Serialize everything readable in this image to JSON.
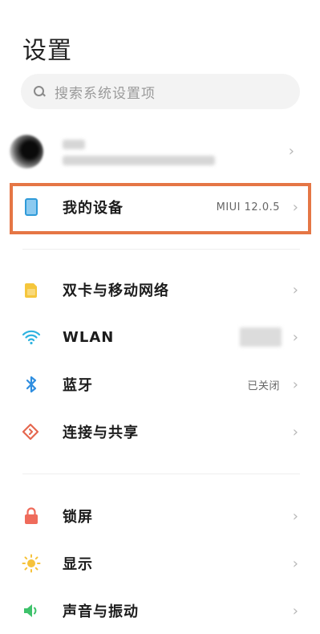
{
  "header": {
    "title": "设置"
  },
  "search": {
    "placeholder": "搜索系统设置项"
  },
  "device": {
    "label": "我的设备",
    "value": "MIUI 12.0.5"
  },
  "network_group": [
    {
      "label": "双卡与移动网络",
      "value": "",
      "icon": "sim-card-icon",
      "color": "#f5c63c"
    },
    {
      "label": "WLAN",
      "value": "",
      "icon": "wifi-icon",
      "color": "#2fb3e0"
    },
    {
      "label": "蓝牙",
      "value": "已关闭",
      "icon": "bluetooth-icon",
      "color": "#2f8ee0"
    },
    {
      "label": "连接与共享",
      "value": "",
      "icon": "connection-share-icon",
      "color": "#e5674f"
    }
  ],
  "display_group": [
    {
      "label": "锁屏",
      "icon": "lock-icon",
      "color": "#ef6b5b"
    },
    {
      "label": "显示",
      "icon": "sun-icon",
      "color": "#f6c23b"
    },
    {
      "label": "声音与振动",
      "icon": "speaker-icon",
      "color": "#3ec26b"
    }
  ],
  "colors": {
    "highlight": "#e57645",
    "chevron": "#b8b8b8"
  }
}
